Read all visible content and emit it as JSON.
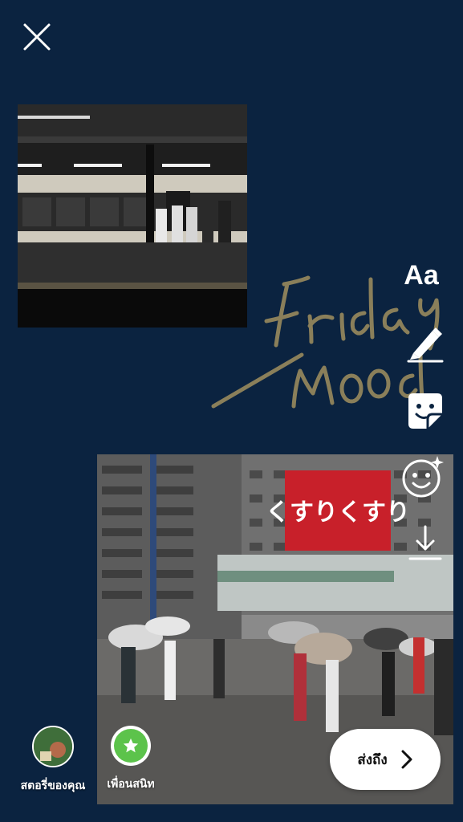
{
  "toolbar": {
    "close_icon": "close-icon",
    "text_tool_label": "Aa",
    "pen_icon": "pen-icon",
    "sticker_icon": "sticker-icon",
    "effect_icon": "face-sparkle-icon",
    "download_icon": "download-icon"
  },
  "canvas": {
    "handwriting_lines": [
      "Friday",
      "Mood"
    ],
    "handwriting_color": "#8a7f5a",
    "street_sign_text": "くすりくすり"
  },
  "share": {
    "story_label": "สตอรี่ของคุณ",
    "friends_label": "เพื่อนสนิท",
    "friends_color": "#5cc34b",
    "send_label": "ส่งถึง"
  },
  "colors": {
    "background": "#0b2340",
    "button_bg": "#ffffff"
  }
}
